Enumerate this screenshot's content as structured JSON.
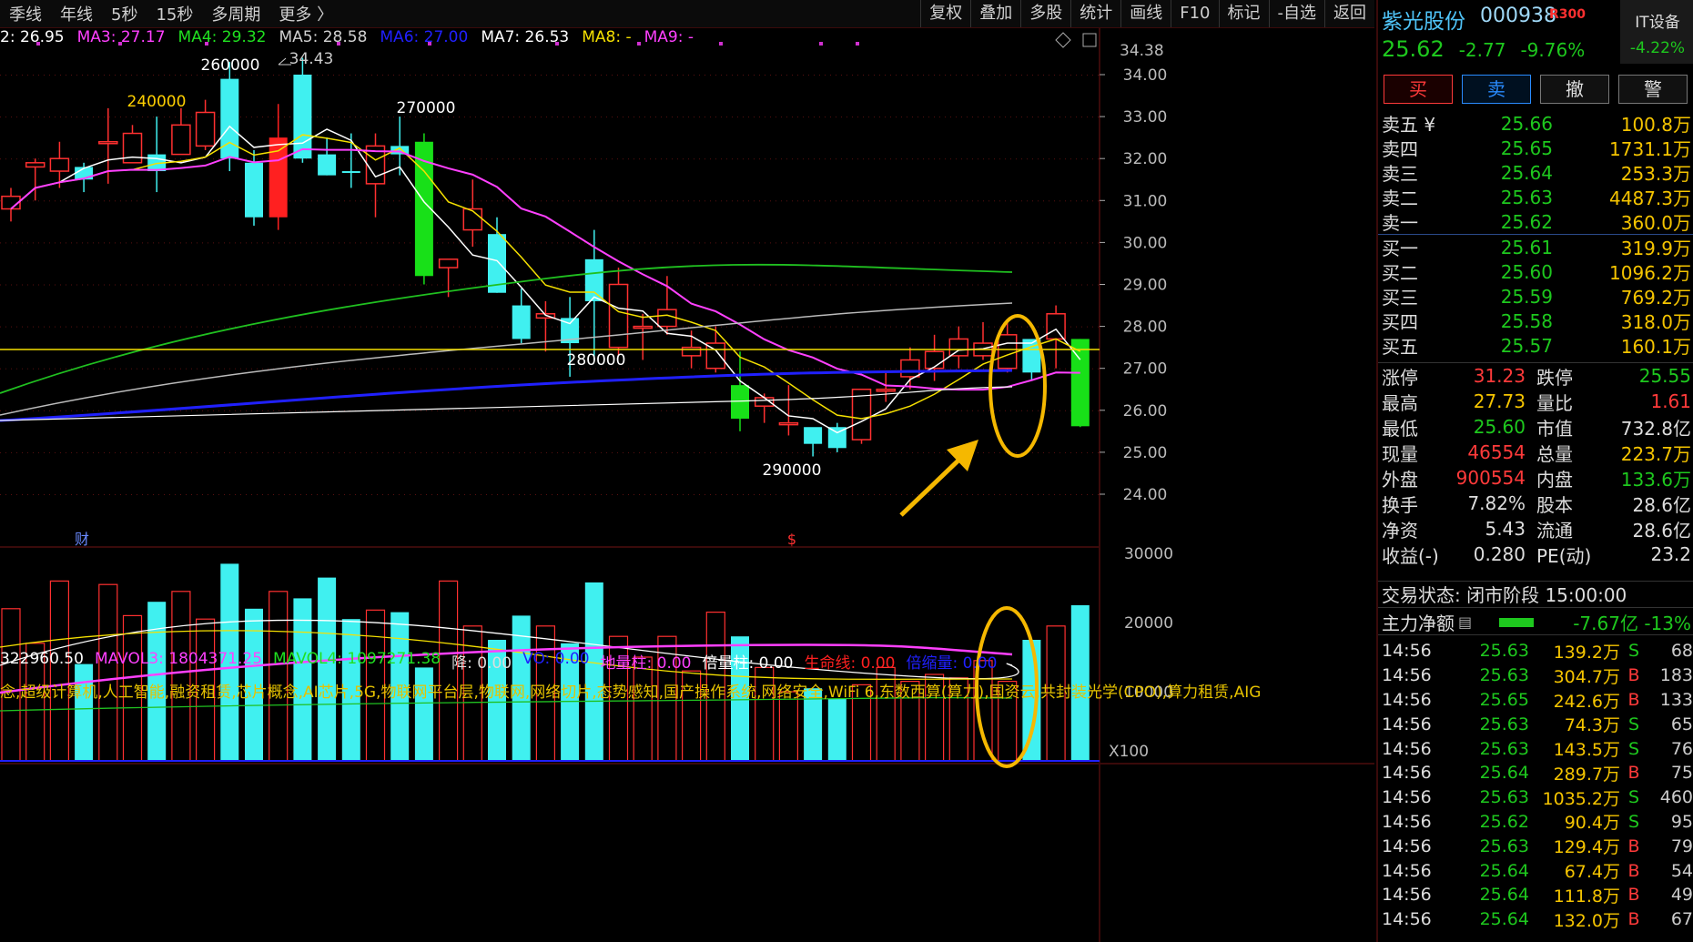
{
  "topbar": {
    "left_items": [
      "季线",
      "年线",
      "5秒",
      "15秒",
      "多周期",
      "更多 〉"
    ],
    "right_items": [
      "复权",
      "叠加",
      "多股",
      "统计",
      "画线",
      "F10",
      "标记",
      "-自选",
      "返回"
    ]
  },
  "ma_legend": [
    {
      "text": "2: 26.95",
      "color": "#ffffff"
    },
    {
      "text": "MA3: 27.17",
      "color": "#ff40ff"
    },
    {
      "text": "MA4: 29.32",
      "color": "#20e020"
    },
    {
      "text": "MA5: 28.58",
      "color": "#d0d0d0"
    },
    {
      "text": "MA6: 27.00",
      "color": "#2020ff"
    },
    {
      "text": "MA7: 26.53",
      "color": "#ffffff"
    },
    {
      "text": "MA8: -",
      "color": "#f5e000"
    },
    {
      "text": "MA9: -",
      "color": "#ff40ff"
    }
  ],
  "vol_legend": [
    {
      "text": "322960.50",
      "color": "#ffffff"
    },
    {
      "text": "MAVOL3: 1804371.25",
      "color": "#ff40ff"
    },
    {
      "text": "MAVOL4: 1097271.38",
      "color": "#20e020"
    },
    {
      "text": "降: 0.00",
      "color": "#dddddd"
    },
    {
      "text": "VO: 0.00",
      "color": "#2020ff"
    },
    {
      "text": "地量柱: 0.00",
      "color": "#ff40ff"
    },
    {
      "text": "倍量柱: 0.00",
      "color": "#ffffff"
    },
    {
      "text": "生命线: 0.00",
      "color": "#ff2020"
    },
    {
      "text": "倍缩量: 0.00",
      "color": "#2020ff"
    }
  ],
  "concepts": "念,超级计算机,人工智能,融资租赁,芯片概念,AI芯片,5G,物联网平台层,物联网,网络切片,态势感知,国产操作系统,网络安全,WiFi 6,东数西算(算力),国资云,共封装光学(CPO),算力租赁,AIG",
  "chart_data": {
    "type": "candlestick",
    "price_axis": {
      "ticks": [
        34.0,
        33.0,
        32.0,
        31.0,
        30.0,
        29.0,
        28.0,
        27.0,
        26.0,
        25.0,
        24.0
      ],
      "top_label": "34.38"
    },
    "volume_axis": {
      "ticks": [
        30000,
        20000,
        10000
      ],
      "unit": "X100"
    },
    "annotations": [
      "260000",
      "34.43",
      "240000",
      "270000",
      "280000",
      "290000"
    ],
    "markers": [
      "财",
      "$"
    ],
    "candles": [
      [
        31.1,
        31.3,
        30.5,
        30.8
      ],
      [
        31.9,
        32.0,
        31.0,
        31.8
      ],
      [
        32.0,
        32.4,
        31.3,
        31.7
      ],
      [
        31.5,
        31.9,
        31.2,
        31.8
      ],
      [
        32.4,
        33.2,
        31.4,
        32.4
      ],
      [
        32.6,
        32.8,
        31.9,
        31.9
      ],
      [
        32.1,
        33.0,
        31.2,
        31.7
      ],
      [
        32.8,
        33.2,
        32.1,
        32.1
      ],
      [
        33.1,
        33.4,
        32.2,
        32.3
      ],
      [
        32.0,
        34.3,
        31.7,
        33.9
      ],
      [
        31.9,
        32.2,
        30.4,
        30.6
      ],
      [
        30.6,
        33.3,
        30.3,
        32.5
      ],
      [
        32.0,
        34.4,
        31.9,
        34.0
      ],
      [
        32.1,
        32.5,
        31.6,
        31.6
      ],
      [
        31.7,
        32.6,
        31.3,
        31.7
      ],
      [
        32.3,
        32.6,
        30.6,
        31.4
      ],
      [
        32.1,
        33.0,
        31.6,
        32.3
      ],
      [
        32.4,
        32.6,
        29.0,
        29.2
      ],
      [
        29.4,
        29.6,
        28.7,
        29.6
      ],
      [
        30.8,
        31.5,
        29.9,
        30.3
      ],
      [
        30.2,
        30.6,
        28.8,
        28.8
      ],
      [
        28.5,
        28.9,
        27.6,
        27.7
      ],
      [
        28.2,
        28.6,
        27.4,
        28.3
      ],
      [
        27.6,
        28.7,
        26.8,
        28.2
      ],
      [
        28.6,
        30.3,
        27.2,
        29.6
      ],
      [
        29.0,
        29.4,
        27.3,
        27.5
      ],
      [
        28.0,
        28.3,
        27.2,
        28.0
      ],
      [
        28.4,
        29.2,
        27.8,
        28.0
      ],
      [
        27.5,
        27.9,
        27.0,
        27.3
      ],
      [
        27.6,
        28.0,
        26.9,
        27.0
      ],
      [
        26.6,
        27.4,
        25.5,
        25.8
      ],
      [
        26.3,
        26.4,
        25.7,
        26.1
      ],
      [
        25.7,
        26.6,
        25.4,
        25.7
      ],
      [
        25.2,
        25.4,
        24.9,
        25.6
      ],
      [
        25.6,
        25.7,
        25.0,
        25.1
      ],
      [
        25.3,
        26.5,
        25.2,
        26.5
      ],
      [
        26.5,
        26.9,
        26.2,
        26.5
      ],
      [
        26.8,
        27.5,
        26.5,
        27.2
      ],
      [
        27.0,
        27.8,
        26.7,
        27.4
      ],
      [
        27.3,
        28.0,
        27.0,
        27.7
      ],
      [
        27.6,
        28.1,
        27.2,
        27.3
      ],
      [
        27.0,
        28.1,
        26.9,
        27.8
      ],
      [
        26.9,
        27.6,
        26.7,
        27.7
      ],
      [
        27.7,
        28.5,
        27.0,
        28.3
      ],
      [
        27.7,
        27.7,
        25.6,
        25.62
      ]
    ],
    "candle_colors": [
      "h",
      "h",
      "h",
      "c",
      "h",
      "h",
      "c",
      "h",
      "h",
      "c",
      "c",
      "r",
      "c",
      "c",
      "c",
      "h",
      "c",
      "g",
      "h",
      "h",
      "c",
      "c",
      "h",
      "c",
      "c",
      "h",
      "h",
      "h",
      "h",
      "h",
      "g",
      "h",
      "h",
      "c",
      "c",
      "h",
      "h",
      "h",
      "h",
      "h",
      "h",
      "h",
      "c",
      "h",
      "g"
    ],
    "volumes": [
      22000,
      17000,
      26000,
      14000,
      25500,
      21000,
      23000,
      24500,
      20500,
      28500,
      22000,
      24500,
      23500,
      26500,
      20500,
      21800,
      21500,
      13500,
      26000,
      19500,
      17500,
      21000,
      19500,
      17000,
      25800,
      18000,
      15000,
      18000,
      13000,
      21500,
      18000,
      13500,
      10000,
      10500,
      9000,
      11000,
      13500,
      11500,
      12500,
      12000,
      14500,
      11500,
      17500,
      19500,
      22500
    ]
  },
  "panel": {
    "name": "紫光股份",
    "code": "000938",
    "badge": "R300",
    "it_label": "IT设备",
    "it_change": "-4.22%",
    "price": "25.62",
    "change": "-2.77",
    "change_pct": "-9.76%",
    "buttons": [
      "买",
      "卖",
      "撤",
      "警"
    ],
    "asks": [
      {
        "label": "卖五 ¥",
        "price": "25.66",
        "vol": "100.8万"
      },
      {
        "label": "卖四",
        "price": "25.65",
        "vol": "1731.1万"
      },
      {
        "label": "卖三",
        "price": "25.64",
        "vol": "253.3万"
      },
      {
        "label": "卖二",
        "price": "25.63",
        "vol": "4487.3万"
      },
      {
        "label": "卖一",
        "price": "25.62",
        "vol": "360.0万"
      }
    ],
    "bids": [
      {
        "label": "买一",
        "price": "25.61",
        "vol": "319.9万"
      },
      {
        "label": "买二",
        "price": "25.60",
        "vol": "1096.2万"
      },
      {
        "label": "买三",
        "price": "25.59",
        "vol": "769.2万"
      },
      {
        "label": "买四",
        "price": "25.58",
        "vol": "318.0万"
      },
      {
        "label": "买五",
        "price": "25.57",
        "vol": "160.1万"
      }
    ],
    "stats": [
      {
        "k1": "涨停",
        "v1": "31.23",
        "c1": "#ff3a3a",
        "k2": "跌停",
        "v2": "25.55",
        "c2": "#1ec81e"
      },
      {
        "k1": "最高",
        "v1": "27.73",
        "c1": "#f5c400",
        "k2": "量比",
        "v2": "1.61",
        "c2": "#ff3a3a"
      },
      {
        "k1": "最低",
        "v1": "25.60",
        "c1": "#1ec81e",
        "k2": "市值",
        "v2": "732.8亿",
        "c2": "#dddddd"
      },
      {
        "k1": "现量",
        "v1": "46554",
        "c1": "#ff3a3a",
        "k2": "总量",
        "v2": "223.7万",
        "c2": "#f5c400"
      },
      {
        "k1": "外盘",
        "v1": "900554",
        "c1": "#ff3a3a",
        "k2": "内盘",
        "v2": "133.6万",
        "c2": "#1ec81e"
      },
      {
        "k1": "换手",
        "v1": "7.82%",
        "c1": "#dddddd",
        "k2": "股本",
        "v2": "28.6亿",
        "c2": "#dddddd"
      },
      {
        "k1": "净资",
        "v1": "5.43",
        "c1": "#dddddd",
        "k2": "流通",
        "v2": "28.6亿",
        "c2": "#dddddd"
      },
      {
        "k1": "收益(-)",
        "v1": "0.280",
        "c1": "#dddddd",
        "k2": "PE(动)",
        "v2": "23.2",
        "c2": "#dddddd"
      }
    ],
    "status": "交易状态: 闭市阶段 15:00:00",
    "main_force_label": "主力净额",
    "main_force_value": "-7.67亿 -13%",
    "ticks": [
      {
        "t": "14:56",
        "p": "25.63",
        "a": "139.2万",
        "s": "S",
        "n": "68"
      },
      {
        "t": "14:56",
        "p": "25.63",
        "a": "304.7万",
        "s": "B",
        "n": "183"
      },
      {
        "t": "14:56",
        "p": "25.65",
        "a": "242.6万",
        "s": "B",
        "n": "133"
      },
      {
        "t": "14:56",
        "p": "25.63",
        "a": "74.3万",
        "s": "S",
        "n": "65"
      },
      {
        "t": "14:56",
        "p": "25.63",
        "a": "143.5万",
        "s": "S",
        "n": "76"
      },
      {
        "t": "14:56",
        "p": "25.64",
        "a": "289.7万",
        "s": "B",
        "n": "75"
      },
      {
        "t": "14:56",
        "p": "25.63",
        "a": "1035.2万",
        "s": "S",
        "n": "460"
      },
      {
        "t": "14:56",
        "p": "25.62",
        "a": "90.4万",
        "s": "S",
        "n": "95"
      },
      {
        "t": "14:56",
        "p": "25.63",
        "a": "129.4万",
        "s": "B",
        "n": "79"
      },
      {
        "t": "14:56",
        "p": "25.64",
        "a": "67.4万",
        "s": "B",
        "n": "54"
      },
      {
        "t": "14:56",
        "p": "25.64",
        "a": "111.8万",
        "s": "B",
        "n": "49"
      },
      {
        "t": "14:56",
        "p": "25.64",
        "a": "132.0万",
        "s": "B",
        "n": "67"
      }
    ]
  }
}
